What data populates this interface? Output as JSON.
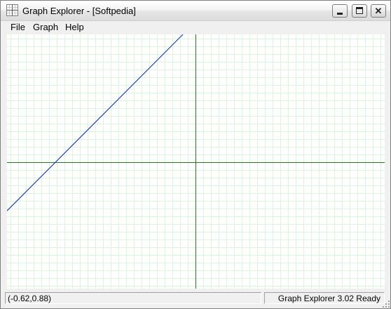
{
  "window": {
    "title": "Graph Explorer - [Softpedia]"
  },
  "menu": {
    "items": [
      "File",
      "Graph",
      "Help"
    ]
  },
  "titlebar_buttons": {
    "minimize": "minimize-icon",
    "maximize": "maximize-icon",
    "close": "close-icon"
  },
  "graph": {
    "x_range": [
      -1.5,
      1.5
    ],
    "y_range": [
      -1.0,
      1.0
    ],
    "grid": true,
    "grid_color": "#d9f5dc",
    "axis_color": "#1f7a1f",
    "line_color": "#2a3fb0",
    "line_points": [
      [
        -1.5,
        -0.38
      ],
      [
        -0.1,
        1.0
      ]
    ]
  },
  "status": {
    "coordinates": "(-0.62,0.88)",
    "message": "Graph Explorer 3.02 Ready"
  }
}
